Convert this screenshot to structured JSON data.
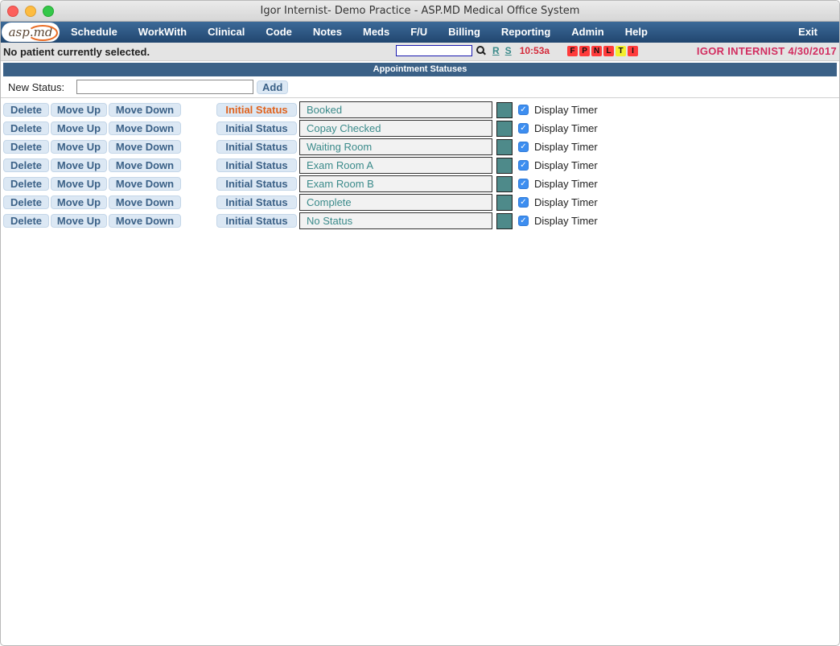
{
  "window": {
    "title": "Igor Internist- Demo Practice - ASP.MD Medical Office System"
  },
  "logo": {
    "text": "asp.md"
  },
  "nav": {
    "items": [
      "Schedule",
      "WorkWith",
      "Clinical",
      "Code",
      "Notes",
      "Meds",
      "F/U",
      "Billing",
      "Reporting",
      "Admin",
      "Help"
    ],
    "exit": "Exit"
  },
  "statusbar": {
    "patient": "No patient currently selected.",
    "search_value": "",
    "link_r": "R",
    "link_s": "S",
    "time": "10:53a",
    "flags": [
      "F",
      "P",
      "N",
      "L",
      "T",
      "I"
    ],
    "user_date": "IGOR INTERNIST 4/30/2017"
  },
  "section": {
    "title": "Appointment Statuses"
  },
  "new_status": {
    "label": "New Status:",
    "value": "",
    "add_label": "Add"
  },
  "buttons": {
    "delete": "Delete",
    "move_up": "Move Up",
    "move_down": "Move Down",
    "initial": "Initial Status",
    "timer_label": "Display Timer"
  },
  "statuses": [
    {
      "name": "Booked",
      "initial": true,
      "timer": true,
      "color": "#4e8a8a"
    },
    {
      "name": "Copay Checked",
      "initial": false,
      "timer": true,
      "color": "#4e8a8a"
    },
    {
      "name": "Waiting Room",
      "initial": false,
      "timer": true,
      "color": "#4e8a8a"
    },
    {
      "name": "Exam Room A",
      "initial": false,
      "timer": true,
      "color": "#4e8a8a"
    },
    {
      "name": "Exam Room B",
      "initial": false,
      "timer": true,
      "color": "#4e8a8a"
    },
    {
      "name": "Complete",
      "initial": false,
      "timer": true,
      "color": "#4e8a8a"
    },
    {
      "name": "No Status",
      "initial": false,
      "timer": true,
      "color": "#4e8a8a"
    }
  ],
  "colors": {
    "nav_bg": "#2d5783",
    "accent_teal": "#3a8a8a",
    "initial_active": "#e0621c",
    "user_date": "#d22d60",
    "clock": "#d42a3a"
  }
}
